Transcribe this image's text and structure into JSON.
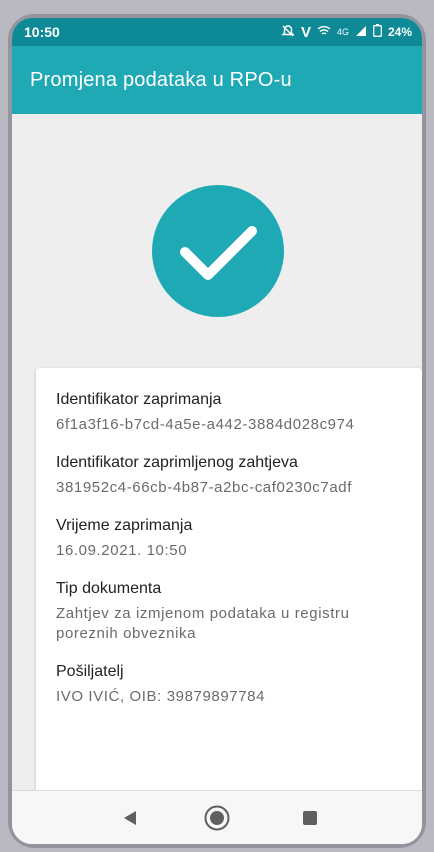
{
  "status_bar": {
    "time": "10:50",
    "network": "4G",
    "battery": "24%",
    "icons": [
      "mute-icon",
      "volte-icon",
      "wifi-icon",
      "signal-icon",
      "battery-icon"
    ]
  },
  "app_bar": {
    "title": "Promjena podataka u RPO-u"
  },
  "success": {
    "icon": "checkmark-icon",
    "color": "#1fa9b5"
  },
  "details": {
    "fields": [
      {
        "label": "Identifikator zaprimanja",
        "value": "6f1a3f16-b7cd-4a5e-a442-3884d028c974"
      },
      {
        "label": "Identifikator zaprimljenog zahtjeva",
        "value": "381952c4-66cb-4b87-a2bc-caf0230c7adf"
      },
      {
        "label": "Vrijeme zaprimanja",
        "value": "16.09.2021. 10:50"
      },
      {
        "label": "Tip dokumenta",
        "value": "Zahtjev za izmjenom podataka u registru poreznih obveznika"
      },
      {
        "label": "Pošiljatelj",
        "value": "IVO IVIĆ, OIB: 39879897784"
      }
    ]
  },
  "nav_bar": {
    "buttons": [
      "back-icon",
      "home-icon",
      "recents-icon"
    ]
  },
  "colors": {
    "status_bar": "#0e8a97",
    "app_bar": "#1fa9b5",
    "background": "#eeeeee",
    "card": "#ffffff"
  }
}
